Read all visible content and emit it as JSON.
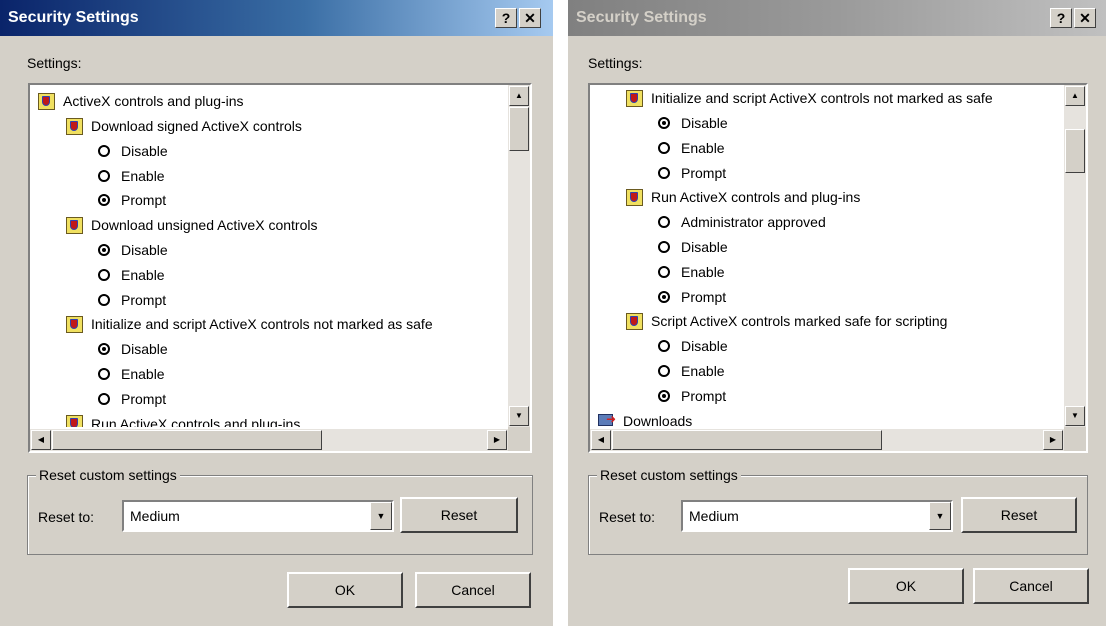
{
  "dialogs": [
    {
      "title": "Security Settings",
      "settings_label": "Settings:",
      "items": [
        {
          "type": "category",
          "label": "ActiveX controls and plug-ins"
        },
        {
          "type": "policy",
          "label": "Download signed ActiveX controls"
        },
        {
          "type": "option",
          "label": "Disable",
          "checked": false
        },
        {
          "type": "option",
          "label": "Enable",
          "checked": false
        },
        {
          "type": "option",
          "label": "Prompt",
          "checked": true
        },
        {
          "type": "policy",
          "label": "Download unsigned ActiveX controls"
        },
        {
          "type": "option",
          "label": "Disable",
          "checked": true
        },
        {
          "type": "option",
          "label": "Enable",
          "checked": false
        },
        {
          "type": "option",
          "label": "Prompt",
          "checked": false
        },
        {
          "type": "policy",
          "label": "Initialize and script ActiveX controls not marked as safe"
        },
        {
          "type": "option",
          "label": "Disable",
          "checked": true
        },
        {
          "type": "option",
          "label": "Enable",
          "checked": false
        },
        {
          "type": "option",
          "label": "Prompt",
          "checked": false
        },
        {
          "type": "policy",
          "label": "Run ActiveX controls and plug-ins"
        }
      ],
      "reset_group_label": "Reset custom settings",
      "reset_to_label": "Reset to:",
      "reset_to_value": "Medium",
      "reset_button": "Reset",
      "ok_button": "OK",
      "cancel_button": "Cancel"
    },
    {
      "title": "Security Settings",
      "settings_label": "Settings:",
      "items": [
        {
          "type": "policy",
          "label": "Initialize and script ActiveX controls not marked as safe"
        },
        {
          "type": "option",
          "label": "Disable",
          "checked": true
        },
        {
          "type": "option",
          "label": "Enable",
          "checked": false
        },
        {
          "type": "option",
          "label": "Prompt",
          "checked": false
        },
        {
          "type": "policy",
          "label": "Run ActiveX controls and plug-ins"
        },
        {
          "type": "option",
          "label": "Administrator approved",
          "checked": false
        },
        {
          "type": "option",
          "label": "Disable",
          "checked": false
        },
        {
          "type": "option",
          "label": "Enable",
          "checked": false
        },
        {
          "type": "option",
          "label": "Prompt",
          "checked": true
        },
        {
          "type": "policy",
          "label": "Script ActiveX controls marked safe for scripting"
        },
        {
          "type": "option",
          "label": "Disable",
          "checked": false
        },
        {
          "type": "option",
          "label": "Enable",
          "checked": false
        },
        {
          "type": "option",
          "label": "Prompt",
          "checked": true
        },
        {
          "type": "category",
          "label": "Downloads"
        }
      ],
      "reset_group_label": "Reset custom settings",
      "reset_to_label": "Reset to:",
      "reset_to_value": "Medium",
      "reset_button": "Reset",
      "ok_button": "OK",
      "cancel_button": "Cancel"
    }
  ],
  "icons": {
    "help": "help-icon",
    "close": "close-icon",
    "policy": "security-policy-icon",
    "download": "download-category-icon"
  },
  "colors": {
    "dialog_bg": "#d4d0c8",
    "active_title": "#0a246a",
    "inactive_title": "#808080"
  }
}
